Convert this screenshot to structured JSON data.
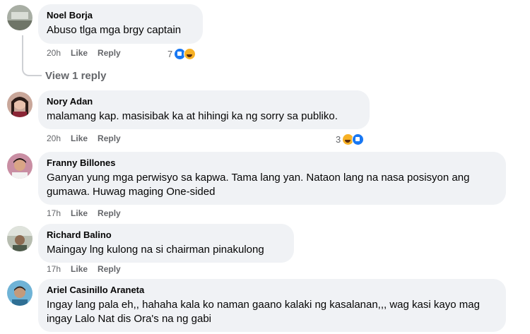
{
  "comments": [
    {
      "name": "Noel Borja",
      "text": "Abuso tlga mga brgy captain",
      "time": "20h",
      "like": "Like",
      "reply": "Reply",
      "reaction_count": "7",
      "reactions": [
        "like-icon",
        "haha-icon"
      ]
    },
    {
      "name": "Nory Adan",
      "text": "malamang kap. masisibak ka at hihingi ka ng sorry sa publiko.",
      "time": "20h",
      "like": "Like",
      "reply": "Reply",
      "reaction_count": "3",
      "reactions": [
        "haha-icon",
        "like-icon"
      ]
    },
    {
      "name": "Franny Billones",
      "text": "Ganyan yung mga perwisyo sa kapwa. Tama lang yan. Nataon lang na nasa posisyon ang gumawa. Huwag maging One-sided",
      "time": "17h",
      "like": "Like",
      "reply": "Reply"
    },
    {
      "name": "Richard Balino",
      "text": "Maingay lng kulong na si chairman pinakulong",
      "time": "17h",
      "like": "Like",
      "reply": "Reply"
    },
    {
      "name": "Ariel Casinillo Araneta",
      "text": "Ingay lang pala eh,, hahaha kala ko naman gaano kalaki ng kasalanan,,, wag kasi kayo mag ingay Lalo Nat dis Ora's na ng gabi"
    }
  ],
  "view_replies": "View 1 reply",
  "colors": {
    "bubble": "#f0f2f5",
    "meta": "#65676b",
    "like": "#1877f2",
    "haha": "#f7b125"
  }
}
